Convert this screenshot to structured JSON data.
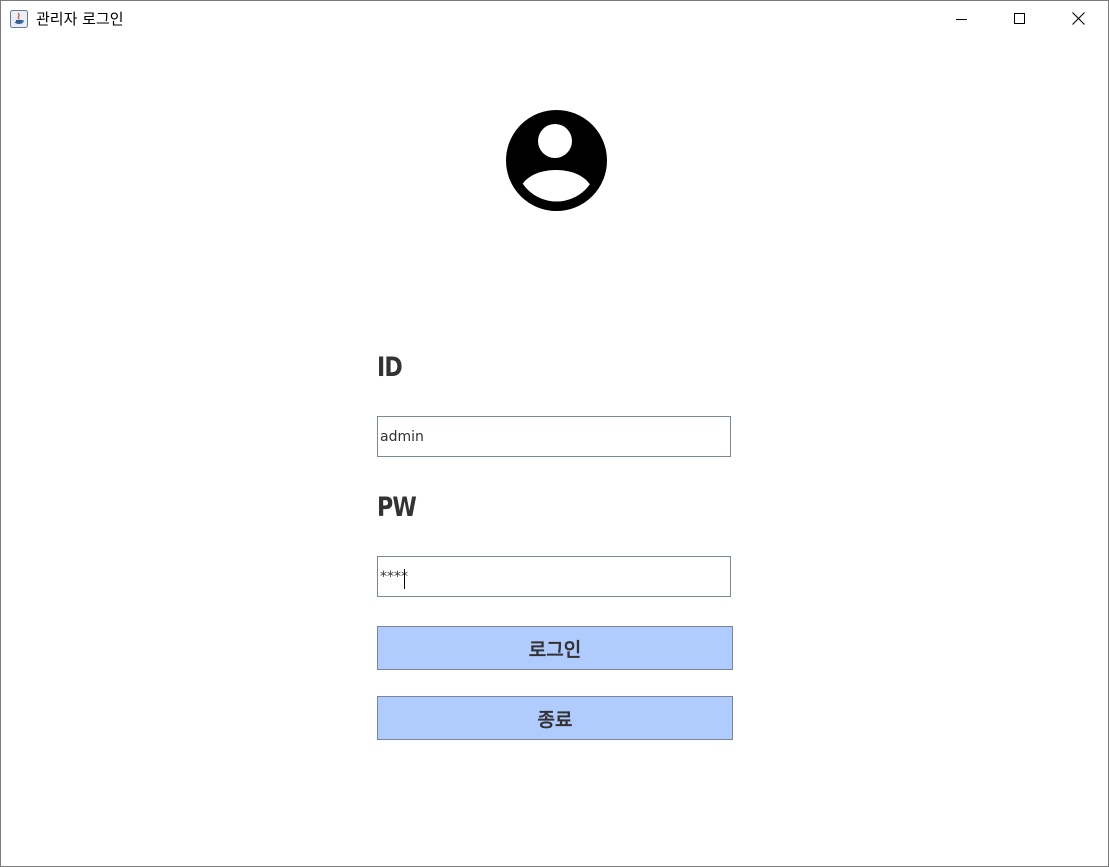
{
  "window": {
    "title": "관리자 로그인",
    "controls": {
      "minimize": "minimize-icon",
      "maximize": "maximize-icon",
      "close": "close-icon"
    }
  },
  "login": {
    "avatar_icon": "user-account-icon",
    "id_label": "ID",
    "id_value": "admin",
    "pw_label": "PW",
    "pw_value": "****",
    "login_button": "로그인",
    "exit_button": "종료"
  },
  "colors": {
    "button_bg": "#b0cbfd",
    "label_text": "#333333"
  }
}
